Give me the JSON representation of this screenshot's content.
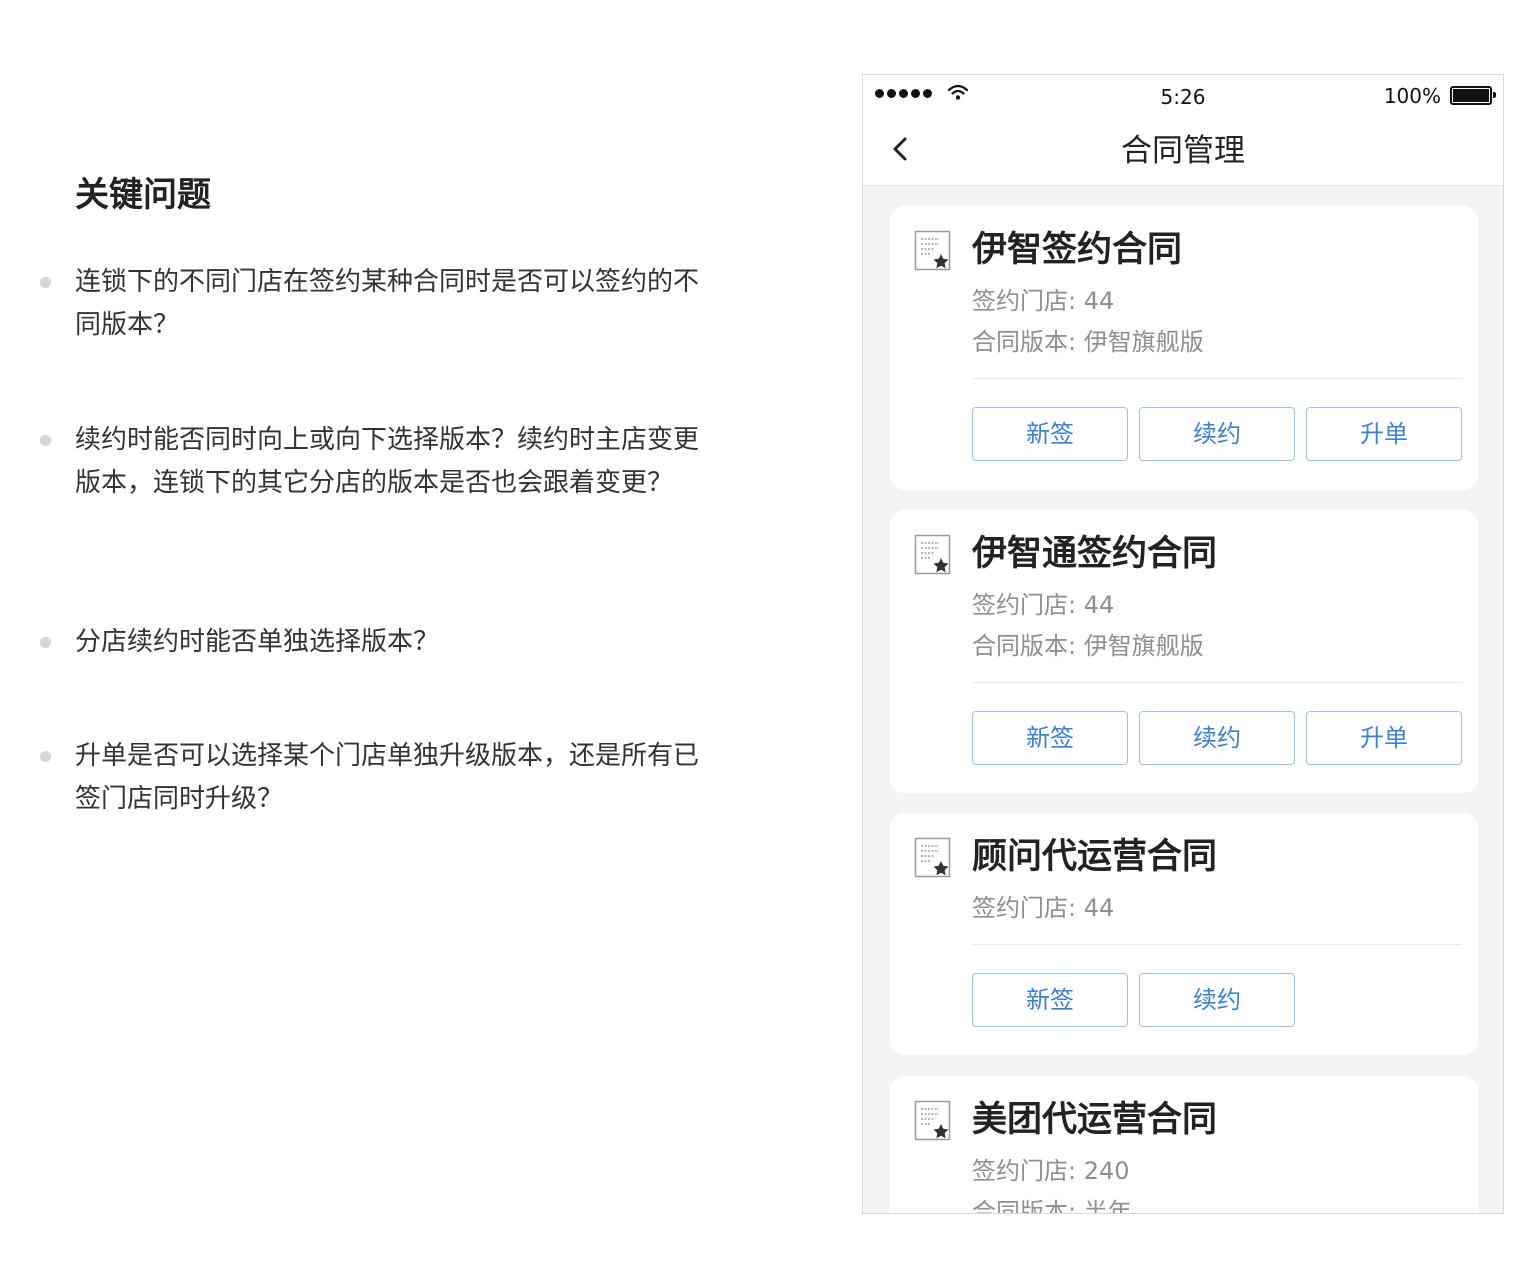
{
  "notes": {
    "title": "关键问题",
    "questions": [
      {
        "text": "连锁下的不同门店在签约某种合同时是否可以签约的不同版本？"
      },
      {
        "text": "续约时能否同时向上或向下选择版本？续约时主店变更版本，连锁下的其它分店的版本是否也会跟着变更？"
      },
      {
        "text": "分店续约时能否单独选择版本？"
      },
      {
        "text": "升单是否可以选择某个门店单独升级版本，还是所有已签门店同时升级？"
      }
    ]
  },
  "status_bar": {
    "time": "5:26",
    "battery": "100%",
    "signal_icon": "signal-dots-icon",
    "wifi_icon": "wifi-icon",
    "battery_icon": "battery-icon"
  },
  "nav": {
    "title": "合同管理",
    "back_icon": "chevron-left-icon"
  },
  "colors": {
    "accent": "#3a7fd8",
    "button_border": "#9fc0ea",
    "meta_text": "#8f8f8f",
    "page_bg": "#f4f4f4"
  },
  "contracts": [
    {
      "icon": "contract-document-star-icon",
      "title": "伊智签约合同",
      "stores_label": "签约门店: 44",
      "version_label": "合同版本: 伊智旗舰版",
      "buttons": [
        {
          "label": "新签"
        },
        {
          "label": "续约"
        },
        {
          "label": "升单"
        }
      ]
    },
    {
      "icon": "contract-document-star-icon",
      "title": "伊智通签约合同",
      "stores_label": "签约门店: 44",
      "version_label": "合同版本: 伊智旗舰版",
      "buttons": [
        {
          "label": "新签"
        },
        {
          "label": "续约"
        },
        {
          "label": "升单"
        }
      ]
    },
    {
      "icon": "contract-document-star-icon",
      "title": "顾问代运营合同",
      "stores_label": "签约门店: 44",
      "buttons": [
        {
          "label": "新签"
        },
        {
          "label": "续约"
        }
      ]
    },
    {
      "icon": "contract-document-star-icon",
      "title": "美团代运营合同",
      "stores_label": "签约门店: 240",
      "version_label": "合同版本: 半年"
    }
  ]
}
